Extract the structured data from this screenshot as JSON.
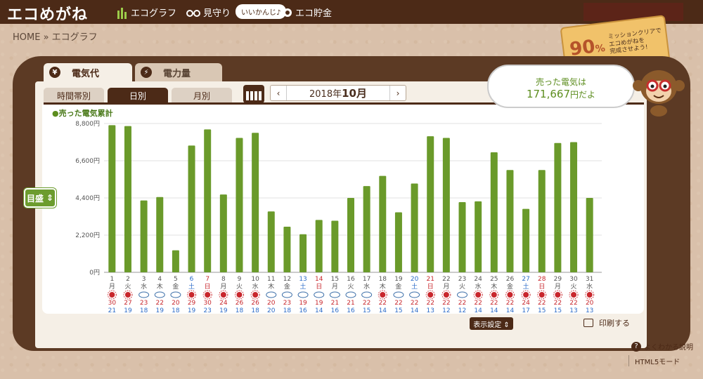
{
  "header": {
    "logo": "エコめがね",
    "nav": [
      {
        "label": "エコグラフ",
        "icon": "bar-chart-icon"
      },
      {
        "label": "見守り",
        "icon": "glasses-icon"
      },
      {
        "label": "エコ貯金",
        "icon": "coin-icon"
      }
    ],
    "badge": "いいかんじ♪"
  },
  "breadcrumb": "HOME » エコグラフ",
  "mission": {
    "percent": "90",
    "percent_symbol": "%",
    "line1": "ミッションクリアで",
    "line2": "エコめがねを",
    "line3": "完成させよう!"
  },
  "tabs": {
    "cost": {
      "label": "電気代",
      "icon": "yen-icon",
      "symbol": "¥"
    },
    "power": {
      "label": "電力量",
      "icon": "lightning-icon",
      "symbol": "⚡"
    }
  },
  "subtabs": {
    "time": "時間帯別",
    "day": "日別",
    "month": "月別"
  },
  "date": {
    "prev": "‹",
    "next": "›",
    "year": "2018年",
    "month": "10月"
  },
  "sold": {
    "line1": "売った電気は",
    "amount": "171,667",
    "suffix": "円だよ"
  },
  "scale_select": {
    "label": "目盛",
    "arrow": "⇕"
  },
  "buttons": {
    "display_settings": "表示設定 ⇕",
    "print": "印刷する"
  },
  "help": {
    "symbol": "?",
    "label": "よくわかる説明"
  },
  "html5_mode": "HTML5モード",
  "colors": {
    "bar": "#6a9a2a",
    "header": "#4c2a17",
    "sun": "#c8272d",
    "cloud": "#3b6ea8",
    "sat": "#2d6cc8",
    "sun_day": "#c8272d"
  },
  "chart_data": {
    "type": "bar",
    "legend": "売った電気累計",
    "ylim": [
      0,
      8800
    ],
    "yticks": [
      "0円",
      "2,200円",
      "4,400円",
      "6,600円",
      "8,800円"
    ],
    "days": [
      "1",
      "2",
      "3",
      "4",
      "5",
      "6",
      "7",
      "8",
      "9",
      "10",
      "11",
      "12",
      "13",
      "14",
      "15",
      "16",
      "17",
      "18",
      "19",
      "20",
      "21",
      "22",
      "23",
      "24",
      "25",
      "26",
      "27",
      "28",
      "29",
      "30",
      "31"
    ],
    "weekdays": [
      "月",
      "火",
      "水",
      "木",
      "金",
      "土",
      "日",
      "月",
      "火",
      "水",
      "木",
      "金",
      "土",
      "日",
      "月",
      "火",
      "水",
      "木",
      "金",
      "土",
      "日",
      "月",
      "火",
      "水",
      "木",
      "金",
      "土",
      "日",
      "月",
      "火",
      "水"
    ],
    "values": [
      8700,
      8650,
      4250,
      4450,
      1300,
      7500,
      8450,
      4600,
      7950,
      8250,
      3600,
      2700,
      2250,
      3100,
      3050,
      4400,
      5100,
      5700,
      3550,
      5250,
      8050,
      7950,
      4150,
      4200,
      7100,
      6050,
      3750,
      6050,
      7650,
      7700,
      4400
    ],
    "weather": [
      "sun",
      "sun",
      "cloud",
      "cloud",
      "cloud",
      "sun",
      "sun",
      "sun",
      "sun",
      "sun",
      "cloud",
      "cloud",
      "cloud",
      "cloud",
      "cloud",
      "cloud",
      "cloud",
      "sun",
      "cloud",
      "cloud",
      "sun",
      "sun",
      "cloud",
      "sun",
      "sun",
      "sun",
      "sun",
      "sun",
      "sun",
      "sun",
      "sun"
    ],
    "high": [
      "30",
      "27",
      "23",
      "22",
      "20",
      "29",
      "30",
      "24",
      "26",
      "26",
      "20",
      "23",
      "19",
      "19",
      "21",
      "21",
      "22",
      "22",
      "22",
      "22",
      "22",
      "22",
      "22",
      "22",
      "22",
      "22",
      "24",
      "22",
      "22",
      "22",
      "20"
    ],
    "low": [
      "21",
      "19",
      "18",
      "19",
      "18",
      "19",
      "23",
      "19",
      "18",
      "18",
      "20",
      "18",
      "16",
      "14",
      "16",
      "16",
      "15",
      "14",
      "15",
      "14",
      "13",
      "12",
      "12",
      "14",
      "14",
      "14",
      "17",
      "15",
      "15",
      "13",
      "13"
    ]
  }
}
